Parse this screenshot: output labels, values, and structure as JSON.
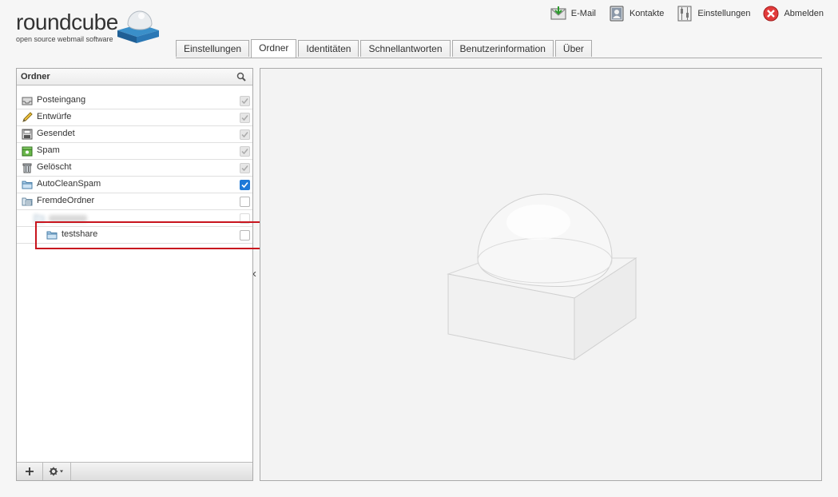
{
  "logo": {
    "name": "roundcube",
    "tagline": "open source webmail software"
  },
  "topnav": [
    {
      "label": "E-Mail",
      "icon": "mail-icon"
    },
    {
      "label": "Kontakte",
      "icon": "contacts-icon"
    },
    {
      "label": "Einstellungen",
      "icon": "settings-icon"
    },
    {
      "label": "Abmelden",
      "icon": "logout-icon"
    }
  ],
  "tabs": [
    {
      "label": "Einstellungen",
      "active": false
    },
    {
      "label": "Ordner",
      "active": true
    },
    {
      "label": "Identitäten",
      "active": false
    },
    {
      "label": "Schnellantworten",
      "active": false
    },
    {
      "label": "Benutzerinformation",
      "active": false
    },
    {
      "label": "Über",
      "active": false
    }
  ],
  "folders_panel": {
    "title": "Ordner",
    "folders": [
      {
        "name": "Posteingang",
        "icon": "inbox-icon",
        "subscribed": "disabled"
      },
      {
        "name": "Entwürfe",
        "icon": "drafts-icon",
        "subscribed": "disabled"
      },
      {
        "name": "Gesendet",
        "icon": "sent-icon",
        "subscribed": "disabled"
      },
      {
        "name": "Spam",
        "icon": "spam-icon",
        "subscribed": "disabled"
      },
      {
        "name": "Gelöscht",
        "icon": "trash-icon",
        "subscribed": "disabled"
      },
      {
        "name": "AutoCleanSpam",
        "icon": "folder-icon",
        "subscribed": "checked"
      },
      {
        "name": "FremdeOrdner",
        "icon": "shared-folder-icon",
        "subscribed": "unchecked"
      },
      {
        "name": "",
        "icon": "folder-icon",
        "subscribed": "unchecked-disabled",
        "blurred": true
      },
      {
        "name": "testshare",
        "icon": "folder-icon",
        "subscribed": "unchecked"
      }
    ],
    "footer": {
      "add": "+",
      "actions": "⚙▾"
    }
  },
  "colors": {
    "accent": "#1e79d8",
    "highlight": "#c8151e",
    "border": "#aaaaaa"
  }
}
